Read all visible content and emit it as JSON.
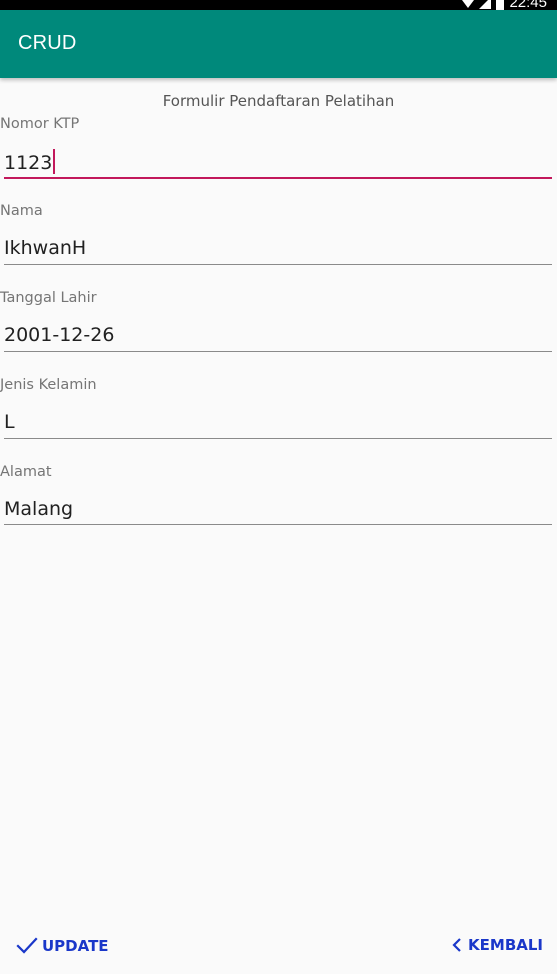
{
  "status_bar": {
    "time": "22:45",
    "icons": [
      "wifi-icon",
      "signal-icon",
      "battery-icon"
    ]
  },
  "app_bar": {
    "title": "CRUD",
    "color": "#00897b"
  },
  "form": {
    "title": "Formulir Pendaftaran Pelatihan",
    "fields": [
      {
        "label": "Nomor KTP",
        "value": "1123",
        "focused": true
      },
      {
        "label": "Nama",
        "value": "IkhwanH",
        "focused": false
      },
      {
        "label": "Tanggal Lahir",
        "value": "2001-12-26",
        "focused": false
      },
      {
        "label": "Jenis Kelamin",
        "value": "L",
        "focused": false
      },
      {
        "label": "Alamat",
        "value": "Malang",
        "focused": false
      }
    ]
  },
  "actions": {
    "update_label": "UPDATE",
    "update_icon": "check-icon",
    "back_label": "KEMBALI",
    "back_icon": "chevron-left-icon",
    "accent": "#1a37c9",
    "focus_color": "#c2185b"
  }
}
